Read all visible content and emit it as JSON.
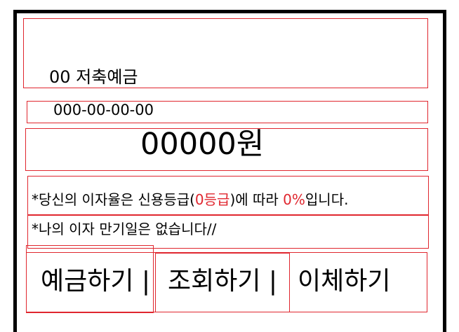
{
  "account": {
    "title": "00 저축예금",
    "number": "000-00-00-00",
    "balance": "00000원"
  },
  "info": {
    "rate_prefix": "*당신의 이자율은 신용등급(",
    "grade": "0등급",
    "rate_mid": ")에 따라 ",
    "rate": "0%",
    "rate_suffix": "입니다.",
    "maturity": "*나의 이자 만기일은 없습니다//"
  },
  "actions": {
    "deposit": "예금하기 |",
    "inquiry": "조회하기 |",
    "transfer": "이체하기"
  },
  "colors": {
    "border": "#e0262e",
    "highlight": "#e0262e",
    "frame": "#000000"
  }
}
